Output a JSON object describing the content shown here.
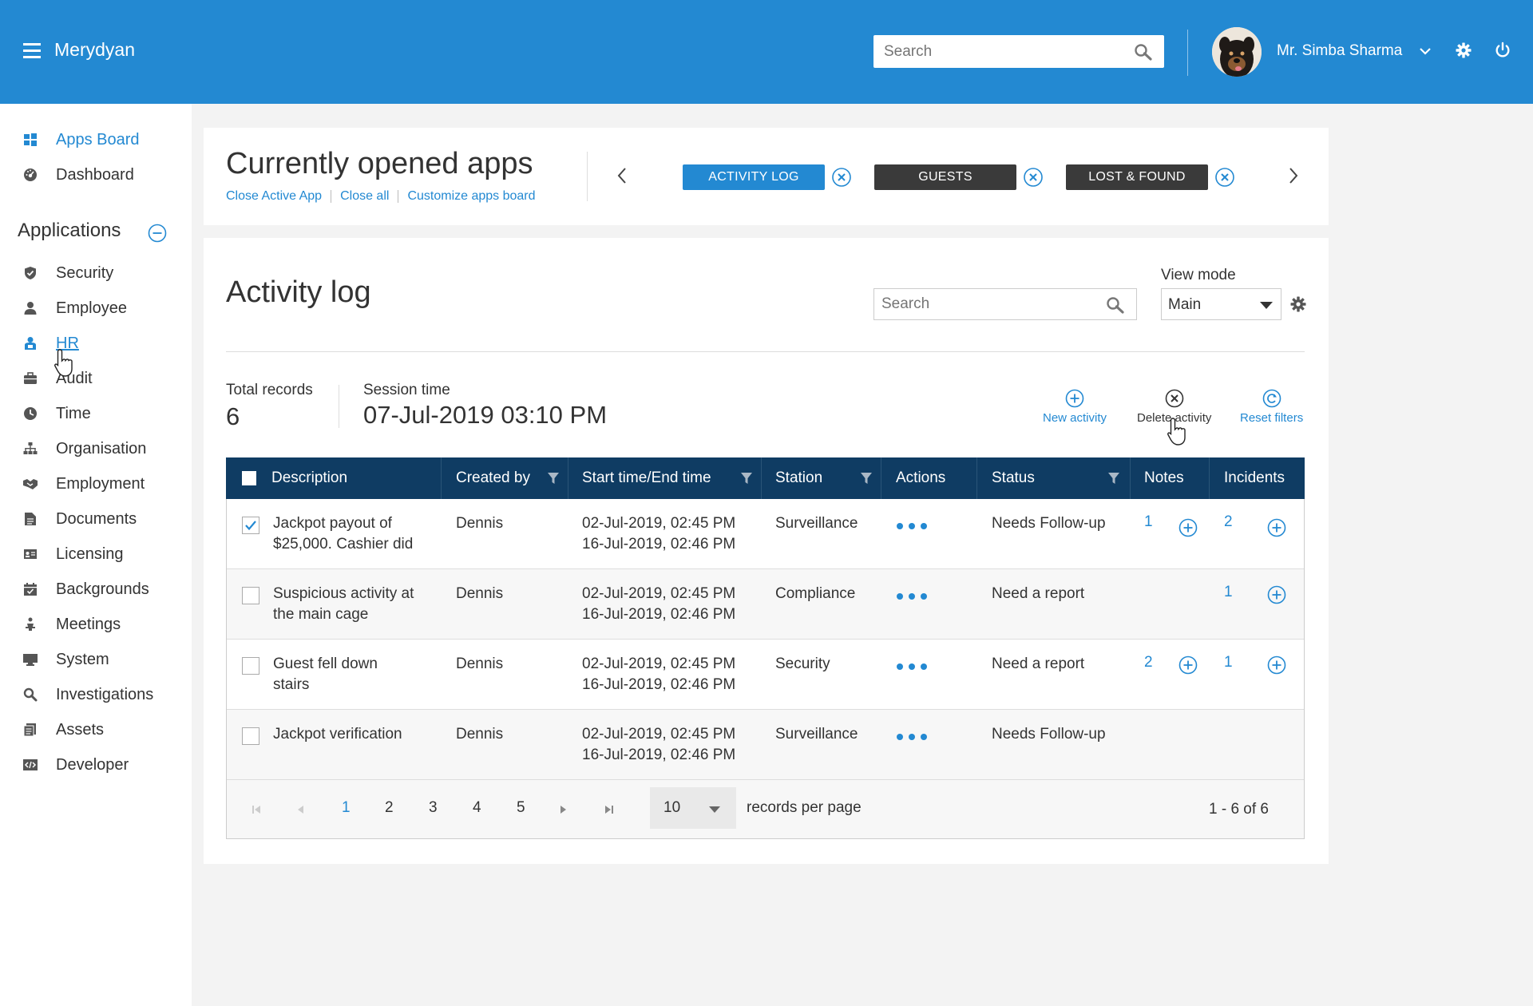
{
  "app": {
    "brand": "Merydyan"
  },
  "header": {
    "search_placeholder": "Search",
    "user_name": "Mr. Simba Sharma"
  },
  "sidebar": {
    "top_items": [
      {
        "label": "Apps Board",
        "icon": "windows-icon"
      },
      {
        "label": "Dashboard",
        "icon": "gauge-icon"
      }
    ],
    "applications_heading": "Applications",
    "items": [
      {
        "label": "Security",
        "icon": "shield-icon"
      },
      {
        "label": "Employee",
        "icon": "user-icon"
      },
      {
        "label": "HR",
        "icon": "hr-icon"
      },
      {
        "label": "Audit",
        "icon": "briefcase-icon"
      },
      {
        "label": "Time",
        "icon": "clock-icon"
      },
      {
        "label": "Organisation",
        "icon": "org-chart-icon"
      },
      {
        "label": "Employment",
        "icon": "handshake-icon"
      },
      {
        "label": "Documents",
        "icon": "document-icon"
      },
      {
        "label": "Licensing",
        "icon": "id-card-icon"
      },
      {
        "label": "Backgrounds",
        "icon": "calendar-check-icon"
      },
      {
        "label": "Meetings",
        "icon": "presenter-icon"
      },
      {
        "label": "System",
        "icon": "monitor-icon"
      },
      {
        "label": "Investigations",
        "icon": "magnifier-icon"
      },
      {
        "label": "Assets",
        "icon": "files-icon"
      },
      {
        "label": "Developer",
        "icon": "code-icon"
      }
    ]
  },
  "opened_apps": {
    "title": "Currently opened apps",
    "links": [
      "Close Active App",
      "Close all",
      "Customize apps board"
    ],
    "tabs": [
      {
        "label": "ACTIVITY LOG",
        "active": true
      },
      {
        "label": "GUESTS",
        "active": false
      },
      {
        "label": "LOST & FOUND",
        "active": false
      }
    ]
  },
  "activity_log": {
    "title": "Activity log",
    "search_placeholder": "Search",
    "view_mode_label": "View mode",
    "view_mode_value": "Main",
    "total_records_label": "Total records",
    "total_records_value": "6",
    "session_time_label": "Session time",
    "session_time_value": "07-Jul-2019 03:10 PM",
    "actions": [
      "New activity",
      "Delete activity",
      "Reset filters"
    ],
    "columns": [
      "Description",
      "Created by",
      "Start time/End time",
      "Station",
      "Actions",
      "Status",
      "Notes",
      "Incidents"
    ],
    "rows": [
      {
        "checked": true,
        "desc1": "Jackpot payout of",
        "desc2": "$25,000. Cashier did",
        "created_by": "Dennis",
        "start": "02-Jul-2019, 02:45 PM",
        "end": "16-Jul-2019, 02:46 PM",
        "station": "Surveillance",
        "status": "Needs Follow-up",
        "notes": "1",
        "incidents": "2"
      },
      {
        "checked": false,
        "desc1": "Suspicious activity at",
        "desc2": "the main cage",
        "created_by": "Dennis",
        "start": "02-Jul-2019, 02:45 PM",
        "end": "16-Jul-2019, 02:46 PM",
        "station": "Compliance",
        "status": "Need a report",
        "notes": "",
        "incidents": "1"
      },
      {
        "checked": false,
        "desc1": "Guest fell down",
        "desc2": "stairs",
        "created_by": "Dennis",
        "start": "02-Jul-2019, 02:45 PM",
        "end": "16-Jul-2019, 02:46 PM",
        "station": "Security",
        "status": "Need a report",
        "notes": "2",
        "incidents": "1"
      },
      {
        "checked": false,
        "desc1": "Jackpot verification",
        "desc2": "",
        "created_by": "Dennis",
        "start": "02-Jul-2019, 02:45 PM",
        "end": "16-Jul-2019, 02:46 PM",
        "station": "Surveillance",
        "status": "Needs Follow-up",
        "notes": "",
        "incidents": ""
      }
    ],
    "pager": {
      "pages": [
        "1",
        "2",
        "3",
        "4",
        "5"
      ],
      "current_page": "1",
      "per_page_value": "10",
      "per_page_label": "records per page",
      "range_info": "1 - 6 of 6"
    }
  },
  "colors": {
    "brand_blue": "#2389d2",
    "header_navy": "#0f3c63",
    "dark_tab": "#3a3a3a"
  }
}
